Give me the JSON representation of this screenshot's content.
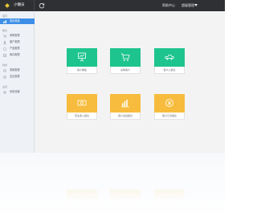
{
  "header": {
    "app_title": "小懒员",
    "help_label": "帮助中心",
    "user_label": "超级管理"
  },
  "sidebar": {
    "sections": [
      {
        "label": "首页",
        "items": [
          {
            "label": "首页看板",
            "icon": "dashboard-icon",
            "active": true
          }
        ]
      },
      {
        "label": "报表",
        "items": [
          {
            "label": "采购报表",
            "icon": "cart-icon"
          },
          {
            "label": "客户报表",
            "icon": "customer-icon"
          },
          {
            "label": "产品报表",
            "icon": "product-icon"
          },
          {
            "label": "库存报表",
            "icon": "inventory-icon"
          }
        ]
      },
      {
        "label": "财务",
        "items": [
          {
            "label": "收款报表",
            "icon": "income-icon"
          },
          {
            "label": "支出报表",
            "icon": "expense-icon"
          }
        ]
      },
      {
        "label": "设置",
        "items": [
          {
            "label": "系统设置",
            "icon": "settings-icon"
          }
        ]
      }
    ]
  },
  "tiles": [
    {
      "label": "客户看板",
      "color": "#1ec48e",
      "icon": "presentation-icon"
    },
    {
      "label": "采购客户",
      "color": "#1ec48e",
      "icon": "cart-icon"
    },
    {
      "label": "客户公报表",
      "color": "#1ec48e",
      "icon": "truck-icon"
    },
    {
      "label": "营业收入报表",
      "color": "#f7bc3d",
      "icon": "money-icon"
    },
    {
      "label": "客户业绩报表",
      "color": "#f7bc3d",
      "icon": "bar-chart-icon"
    },
    {
      "label": "客户汇款报表",
      "color": "#f7bc3d",
      "icon": "yen-coin-icon"
    }
  ],
  "colors": {
    "topbar": "#2f3033",
    "accent": "#3d8ee7",
    "green": "#1ec48e",
    "yellow": "#f7bc3d"
  }
}
